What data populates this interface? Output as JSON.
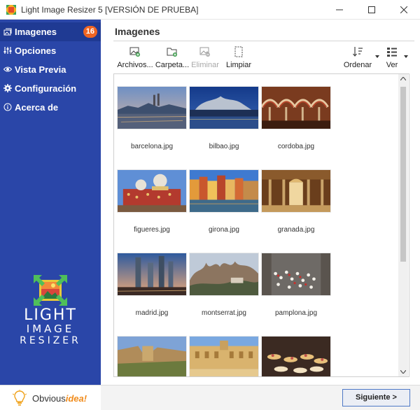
{
  "window": {
    "title": "Light Image Resizer 5  [VERSIÓN DE PRUEBA]",
    "icons": [
      "app-icon",
      "minimize-icon",
      "maximize-icon",
      "close-icon"
    ]
  },
  "sidebar": {
    "items": [
      {
        "label": "Imagenes",
        "icon": "images-icon",
        "badge": "16",
        "active": true
      },
      {
        "label": "Opciones",
        "icon": "sliders-icon",
        "active": false
      },
      {
        "label": "Vista Previa",
        "icon": "eye-icon",
        "active": false
      },
      {
        "label": "Configuración",
        "icon": "gear-icon",
        "active": false
      },
      {
        "label": "Acerca de",
        "icon": "info-icon",
        "active": false
      }
    ],
    "brand": {
      "line1": "LIGHT",
      "line2": "IMAGE",
      "line3": "RESIZER"
    },
    "footer": {
      "brand_a": "Obvious",
      "brand_b": "idea!"
    }
  },
  "main": {
    "title": "Imagenes",
    "toolbar": {
      "archivos": "Archivos...",
      "carpeta": "Carpeta...",
      "eliminar": "Eliminar",
      "limpiar": "Limpiar",
      "ordenar": "Ordenar",
      "ver": "Ver"
    },
    "images": [
      "barcelona.jpg",
      "bilbao.jpg",
      "cordoba.jpg",
      "figueres.jpg",
      "girona.jpg",
      "granada.jpg",
      "madrid.jpg",
      "montserrat.jpg",
      "pamplona.jpg",
      "",
      "",
      ""
    ]
  },
  "footer": {
    "next_label": "Siguiente >"
  },
  "colors": {
    "sidebar": "#2a46a8",
    "sidebar_active": "#1f3a93",
    "badge": "#f06522",
    "accent_orange": "#f08b1b",
    "next_border": "#4d78c6"
  }
}
